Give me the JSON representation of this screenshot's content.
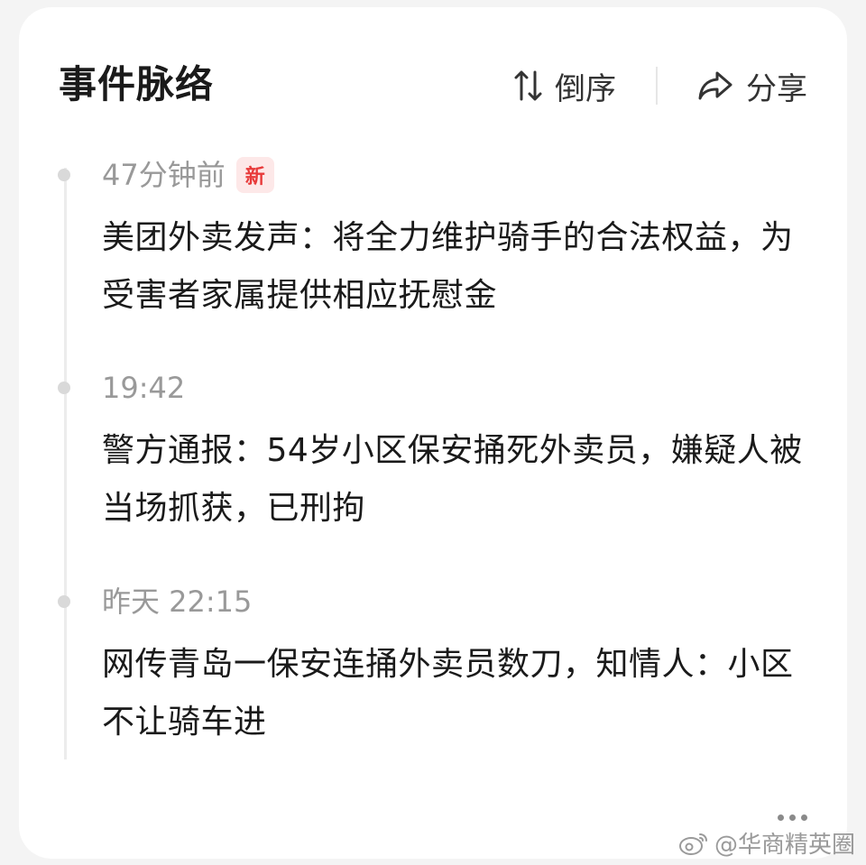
{
  "header": {
    "title": "事件脉络",
    "sort_label": "倒序",
    "share_label": "分享"
  },
  "events": [
    {
      "time": "47分钟前",
      "badge": "新",
      "headline": "美团外卖发声：将全力维护骑手的合法权益，为受害者家属提供相应抚慰金"
    },
    {
      "time": "19:42",
      "headline": "警方通报：54岁小区保安捅死外卖员，嫌疑人被当场抓获，已刑拘"
    },
    {
      "time": "昨天 22:15",
      "headline": "网传青岛一保安连捅外卖员数刀，知情人：小区不让骑车进"
    }
  ],
  "watermark": "@华商精英圈",
  "colors": {
    "badge_bg": "#fde8e8",
    "badge_text": "#e83a3a",
    "time_text": "#999999",
    "headline_text": "#1a1a1a"
  }
}
